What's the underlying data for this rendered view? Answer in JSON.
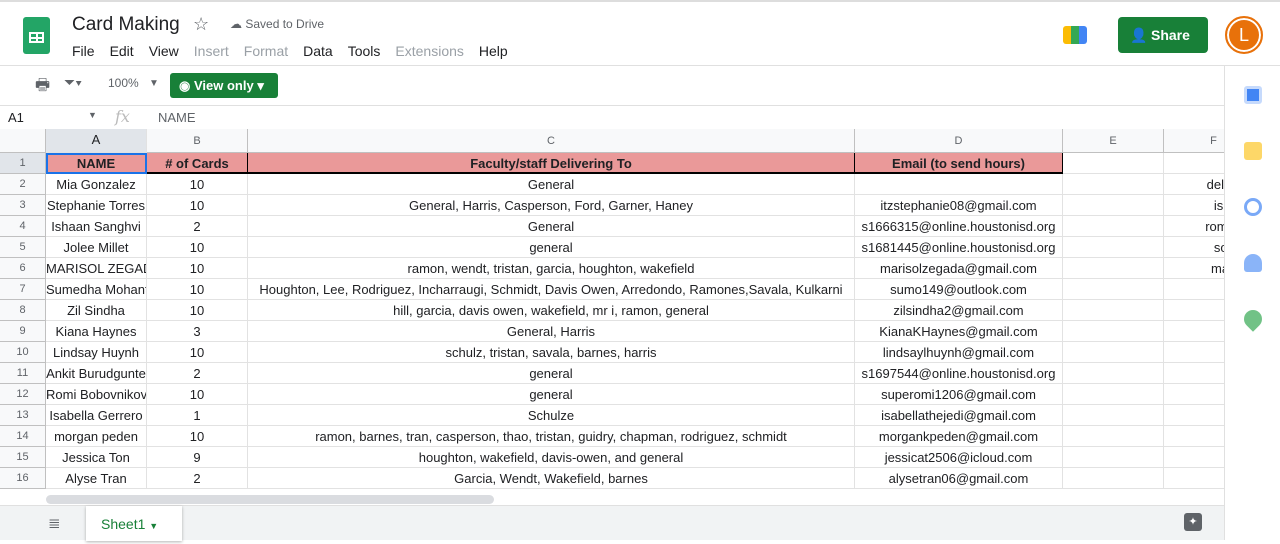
{
  "doc": {
    "title": "Card Making",
    "saved": "Saved to Drive"
  },
  "menu": [
    {
      "label": "File",
      "enabled": true
    },
    {
      "label": "Edit",
      "enabled": true
    },
    {
      "label": "View",
      "enabled": true
    },
    {
      "label": "Insert",
      "enabled": false
    },
    {
      "label": "Format",
      "enabled": false
    },
    {
      "label": "Data",
      "enabled": true
    },
    {
      "label": "Tools",
      "enabled": true
    },
    {
      "label": "Extensions",
      "enabled": false
    },
    {
      "label": "Help",
      "enabled": true
    }
  ],
  "share_label": "Share",
  "avatar_letter": "L",
  "toolbar": {
    "zoom": "100%",
    "view_only": "View only"
  },
  "formula": {
    "cell": "A1",
    "value": "NAME"
  },
  "columns": [
    "A",
    "B",
    "C",
    "D",
    "E",
    "F"
  ],
  "header": [
    "NAME",
    "# of Cards",
    "Faculty/staff Delivering To",
    "Email (to send hours)"
  ],
  "rows": [
    [
      "Mia Gonzalez",
      "10",
      "General",
      "",
      "",
      "deleted le"
    ],
    [
      "Stephanie Torres",
      "10",
      "General, Harris, Casperson, Ford, Garner, Haney",
      "itzstephanie08@gmail.com",
      "",
      "israel ga"
    ],
    [
      "Ishaan Sanghvi",
      "2",
      "General",
      "s1666315@online.houstonisd.org",
      "",
      "romi bobo"
    ],
    [
      "Jolee Millet",
      "10",
      "general",
      "s1681445@online.houstonisd.org",
      "",
      "sophie g"
    ],
    [
      "MARISOL ZEGADA",
      "10",
      "ramon, wendt, tristan, garcia, houghton, wakefield",
      "marisolzegada@gmail.com",
      "",
      "marisol z"
    ],
    [
      "Sumedha Mohanty",
      "10",
      "Houghton, Lee, Rodriguez, Incharraugi, Schmidt, Davis Owen, Arredondo, Ramones,Savala, Kulkarni",
      "sumo149@outlook.com",
      "",
      ""
    ],
    [
      "Zil Sindha",
      "10",
      "hill, garcia, davis owen, wakefield, mr i, ramon, general",
      "zilsindha2@gmail.com",
      "",
      ""
    ],
    [
      "Kiana Haynes",
      "3",
      "General, Harris",
      "KianaKHaynes@gmail.com",
      "",
      ""
    ],
    [
      "Lindsay Huynh",
      "10",
      "schulz, tristan, savala, barnes, harris",
      "lindsaylhuynh@gmail.com",
      "",
      ""
    ],
    [
      "Ankit Burudgunte",
      "2",
      "general",
      "s1697544@online.houstonisd.org",
      "",
      ""
    ],
    [
      "Romi Bobovnikov",
      "10",
      "general",
      "superomi1206@gmail.com",
      "",
      ""
    ],
    [
      "Isabella Gerrero",
      "1",
      "Schulze",
      "isabellathejedi@gmail.com",
      "",
      ""
    ],
    [
      "morgan peden",
      "10",
      "ramon, barnes, tran, casperson, thao, tristan, guidry, chapman, rodriguez, schmidt",
      "morgankpeden@gmail.com",
      "",
      ""
    ],
    [
      "Jessica Ton",
      "9",
      "houghton, wakefield, davis-owen, and general",
      "jessicat2506@icloud.com",
      "",
      ""
    ],
    [
      "Alyse Tran",
      "2",
      "Garcia, Wendt, Wakefield, barnes",
      "alysetran06@gmail.com",
      "",
      ""
    ]
  ],
  "sheet_tab": "Sheet1",
  "colors": {
    "accent": "#188038",
    "header_fill": "#ea9999"
  }
}
